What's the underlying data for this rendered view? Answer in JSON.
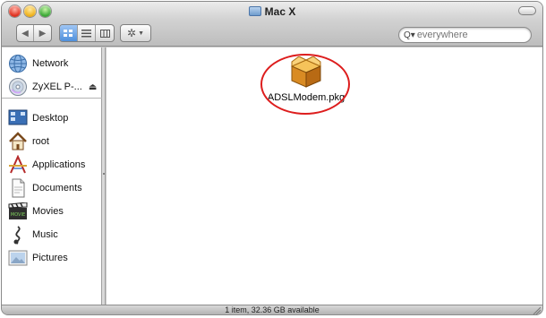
{
  "window": {
    "title": "Mac X",
    "title_icon": "folder-icon"
  },
  "toolbar": {
    "nav_back_icon": "back-arrow-icon",
    "nav_forward_icon": "forward-arrow-icon",
    "view_icons": [
      "icon-view-icon",
      "list-view-icon",
      "column-view-icon"
    ],
    "action_icon": "gear-icon",
    "search_placeholder": "everywhere"
  },
  "sidebar": {
    "devices": [
      {
        "label": "Network",
        "icon": "network-globe-icon"
      },
      {
        "label": "ZyXEL P-...",
        "icon": "cd-disc-icon",
        "eject": true
      }
    ],
    "places": [
      {
        "label": "Desktop",
        "icon": "desktop-icon"
      },
      {
        "label": "root",
        "icon": "home-icon"
      },
      {
        "label": "Applications",
        "icon": "applications-icon"
      },
      {
        "label": "Documents",
        "icon": "documents-icon"
      },
      {
        "label": "Movies",
        "icon": "movies-icon"
      },
      {
        "label": "Music",
        "icon": "music-icon"
      },
      {
        "label": "Pictures",
        "icon": "pictures-icon"
      }
    ]
  },
  "content": {
    "items": [
      {
        "name": "ADSLModem.pkg",
        "icon": "package-icon"
      }
    ]
  },
  "status": {
    "text": "1 item, 32.36 GB available"
  },
  "colors": {
    "highlight_ring": "#dd1d1d",
    "selected_view": "#4f8fdc"
  }
}
